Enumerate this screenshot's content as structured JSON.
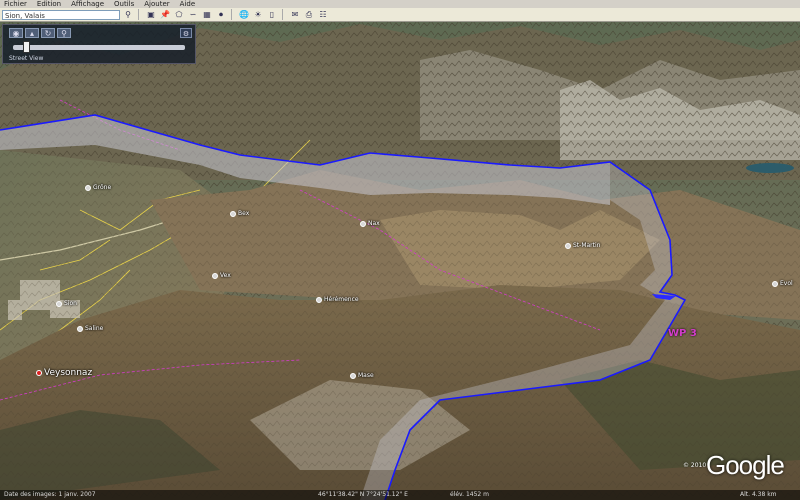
{
  "menu": [
    "Fichier",
    "Edition",
    "Affichage",
    "Outils",
    "Ajouter",
    "Aide"
  ],
  "toolbar": {
    "search_value": "Sion, Valais",
    "buttons": [
      "search-icon",
      "hide-sidebar-icon",
      "placemark-icon",
      "polygon-icon",
      "path-icon",
      "overlay-icon",
      "tour-icon",
      "sky-icon",
      "ruler-icon",
      "email-icon",
      "print-icon",
      "maps-icon"
    ]
  },
  "navigation": {
    "zoom_label": "Street View",
    "zoom_level": 0.06,
    "settings_icon": "wrench-icon"
  },
  "places": {
    "sion": "Sion",
    "saline": "Saline",
    "veysonnaz": "Veysonnaz",
    "vex": "Vex",
    "nax": "Nax",
    "heremence": "Hérémence",
    "st_martin": "St-Martin",
    "evolene": "Evol",
    "bex": "Bex",
    "grone": "Grône",
    "mase": "Mase"
  },
  "waypoint": "WP 3",
  "copyright": "© 2010",
  "google_logo": "Google",
  "status": {
    "imagery_date": "Date des images: 1 janv. 2007",
    "position": "46°11'38.42\" N  7°24'51.12\" E",
    "elevation": "élév. 1452 m",
    "eye_altitude": "Alt. 4.38 km"
  },
  "colors": {
    "track": "#1a1aff",
    "boundary": "#d23cc9",
    "road": "#e8d24a",
    "waypoint": "#d23cc9"
  }
}
